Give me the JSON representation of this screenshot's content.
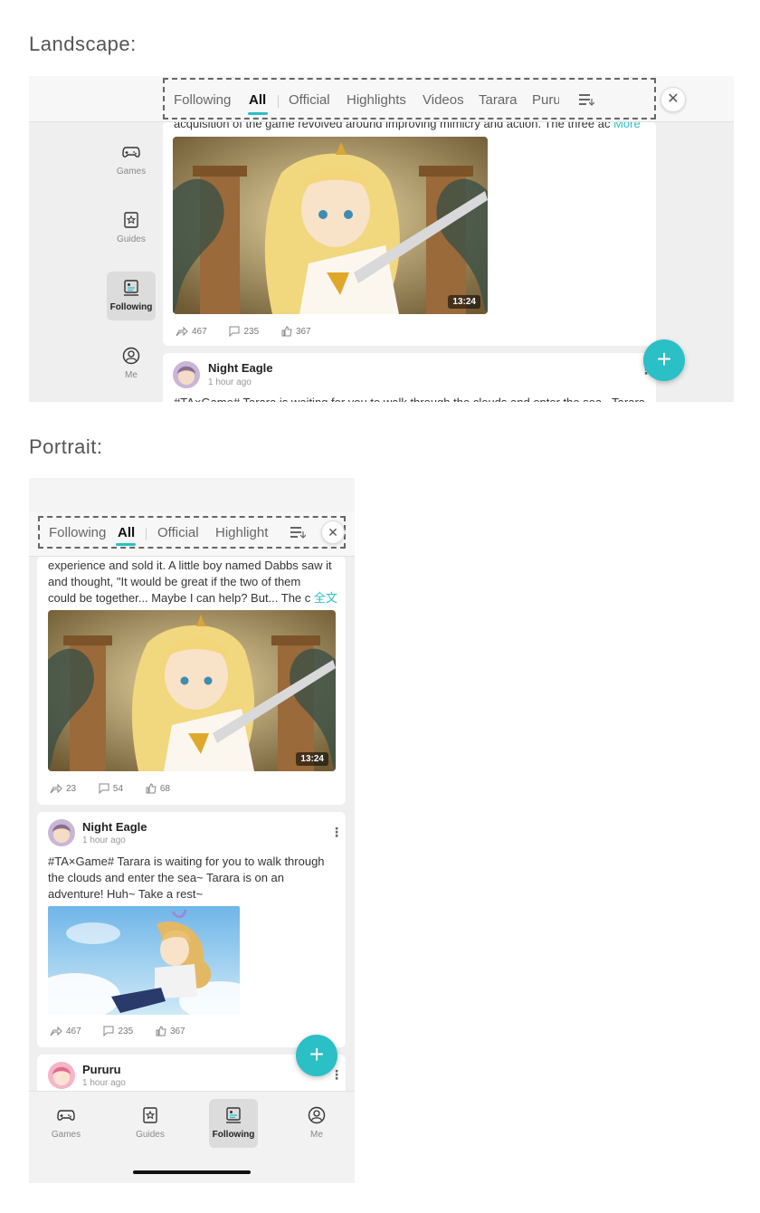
{
  "sections": {
    "landscape_title": "Landscape:",
    "portrait_title": "Portrait:"
  },
  "tabs": {
    "landscape": [
      "Following",
      "All",
      "Official",
      "Highlights",
      "Videos",
      "Tarara",
      "Puru"
    ],
    "portrait": [
      "Following",
      "All",
      "Official",
      "Highlight"
    ],
    "active": "All"
  },
  "nav": {
    "games": "Games",
    "guides": "Guides",
    "following": "Following",
    "me": "Me",
    "active": "Following"
  },
  "landscape": {
    "post1": {
      "text": "acquisition of the game revolved around improving mimicry and action. The three ac",
      "more": "More",
      "duration": "13:24",
      "shares": "467",
      "comments": "235",
      "likes": "367"
    },
    "post2": {
      "author": "Night Eagle",
      "time": "1 hour ago",
      "text": "#TA×Game# Tarara is waiting for you to walk through the clouds and enter the sea~ Tarara"
    }
  },
  "portrait": {
    "post1": {
      "line1": "experience and sold it. A little boy named Dabbs saw it",
      "line2": "and thought, \"It would be great if the two of them",
      "line3": "could be together... Maybe I can help? But... The c",
      "more": "全文",
      "duration": "13:24",
      "shares": "23",
      "comments": "54",
      "likes": "68"
    },
    "post2": {
      "author": "Night Eagle",
      "time": "1 hour ago",
      "line1": "#TA×Game# Tarara is waiting for you to walk through",
      "line2": "the clouds and enter the sea~ Tarara is on an",
      "line3": "adventure! Huh~ Take a rest~",
      "shares": "467",
      "comments": "235",
      "likes": "367"
    },
    "post3": {
      "author": "Pururu",
      "time": "1 hour ago"
    }
  },
  "colors": {
    "accent": "#2bbfc6",
    "background": "#efefef",
    "card": "#ffffff"
  }
}
